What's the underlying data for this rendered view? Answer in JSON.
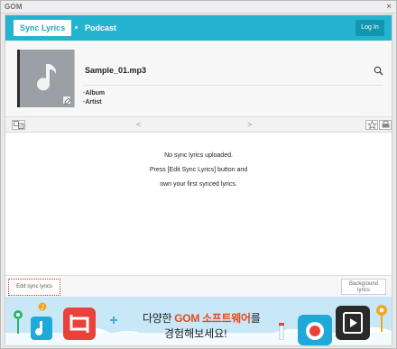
{
  "window": {
    "title": "GOM",
    "close_icon": "close-icon"
  },
  "tabs": [
    {
      "label": "Sync Lyrics",
      "active": true
    },
    {
      "label": "Podcast",
      "active": false
    }
  ],
  "login_label": "Log In",
  "track": {
    "title": "Sample_01.mp3",
    "album_label": "Album",
    "artist_label": "Artist"
  },
  "lyrics_toolbar": {
    "prev_arrow": "<",
    "next_arrow": ">"
  },
  "lyrics": {
    "line1": "No sync lyrics uploaded.",
    "line2": "Press [Edit Sync Lyrics] button and",
    "line3": "own your first synced lyrics."
  },
  "footer": {
    "edit_label": "Edit sync lyrics",
    "background_label_1": "Background",
    "background_label_2": "lyrics"
  },
  "banner": {
    "line1_prefix": "다양한 ",
    "line1_accent": "GOM 소프트웨어",
    "line1_suffix": "를",
    "line2": "경험해보세요!"
  },
  "colors": {
    "accent": "#25b4cf",
    "login_bg": "#1397b0",
    "banner_bg": "#c9e8f7",
    "banner_accent": "#e54a1e",
    "edit_border": "#d9342b"
  }
}
